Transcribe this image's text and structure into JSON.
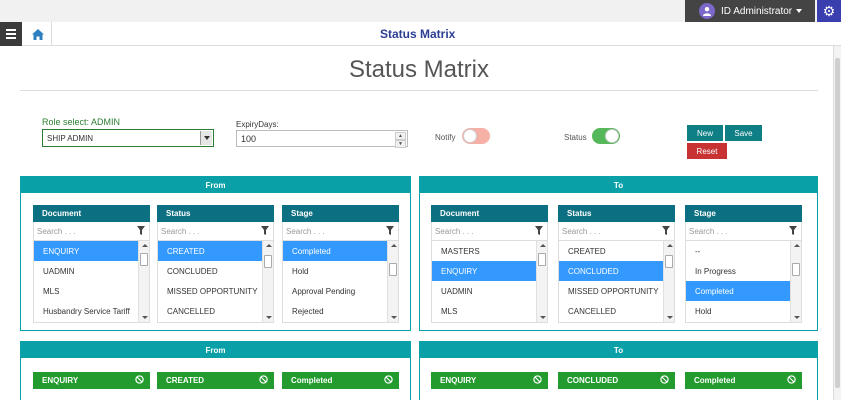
{
  "header": {
    "user_name": "ID Administrator",
    "nav_title": "Status Matrix"
  },
  "page": {
    "heading": "Status Matrix"
  },
  "form": {
    "role_label": "Role select: ADMIN",
    "role_value": "SHIP ADMIN",
    "expiry_label": "ExpiryDays:",
    "expiry_value": "100",
    "notify_label": "Notify",
    "notify_on": false,
    "status_label": "Status",
    "status_on": true,
    "new_label": "New",
    "save_label": "Save",
    "reset_label": "Reset"
  },
  "colors": {
    "teal_header": "#0aa0a8",
    "list_header": "#0c6f82",
    "selected": "#3399ff",
    "chip_green": "#239b2f",
    "reset_red": "#c83232"
  },
  "from_panel": {
    "title": "From",
    "document": {
      "header": "Document",
      "search_placeholder": "Search . . .",
      "items": [
        "ENQUIRY",
        "UADMIN",
        "MLS",
        "Husbandry Service Tariff"
      ],
      "selected_index": 0
    },
    "status": {
      "header": "Status",
      "search_placeholder": "Search . . .",
      "items": [
        "CREATED",
        "CONCLUDED",
        "MISSED OPPORTUNITY",
        "CANCELLED"
      ],
      "selected_index": 0
    },
    "stage": {
      "header": "Stage",
      "search_placeholder": "Search . . .",
      "items": [
        "Completed",
        "Hold",
        "Approval Pending",
        "Rejected"
      ],
      "selected_index": 0
    }
  },
  "to_panel": {
    "title": "To",
    "document": {
      "header": "Document",
      "search_placeholder": "Search . . .",
      "items": [
        "MASTERS",
        "ENQUIRY",
        "UADMIN",
        "MLS"
      ],
      "selected_index": 1
    },
    "status": {
      "header": "Status",
      "search_placeholder": "Search . . .",
      "items": [
        "CREATED",
        "CONCLUDED",
        "MISSED OPPORTUNITY",
        "CANCELLED"
      ],
      "selected_index": 1
    },
    "stage": {
      "header": "Stage",
      "search_placeholder": "Search . . .",
      "items": [
        "--",
        "In Progress",
        "Completed",
        "Hold"
      ],
      "selected_index": 2
    }
  },
  "summary_from": {
    "title": "From",
    "chips": [
      "ENQUIRY",
      "CREATED",
      "Completed"
    ]
  },
  "summary_to": {
    "title": "To",
    "chips": [
      "ENQUIRY",
      "CONCLUDED",
      "Completed"
    ]
  }
}
